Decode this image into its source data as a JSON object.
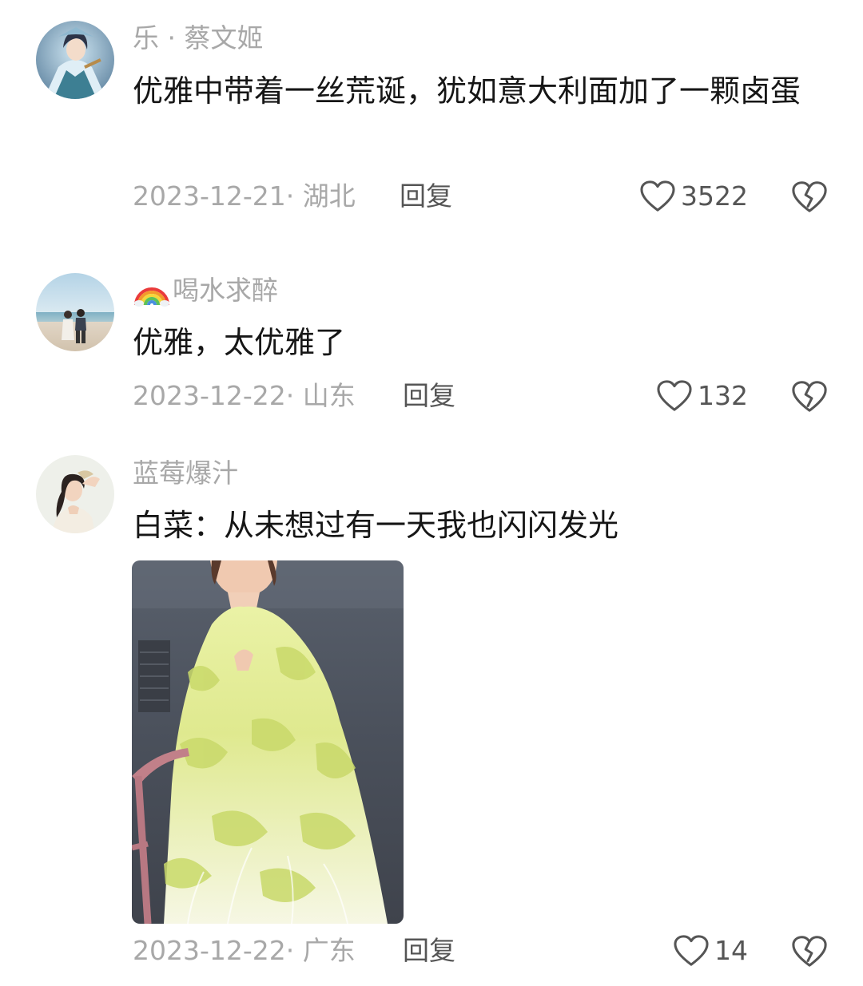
{
  "comments": [
    {
      "username": "乐 · 蔡文姬",
      "content": "优雅中带着一丝荒诞，犹如意大利面加了一颗卤蛋",
      "date_location": "2023-12-21· 湖北",
      "reply_label": "回复",
      "like_count": "3522"
    },
    {
      "username_emoji": "rainbow-icon",
      "username": "喝水求醉",
      "content": "优雅，太优雅了",
      "date_location": "2023-12-22· 山东",
      "reply_label": "回复",
      "like_count": "132"
    },
    {
      "username": "蓝莓爆汁",
      "content": "白菜：从未想过有一天我也闪闪发光",
      "date_location": "2023-12-22· 广东",
      "reply_label": "回复",
      "like_count": "14"
    }
  ],
  "icons": {
    "like": "heart-outline-icon",
    "dislike": "broken-heart-icon"
  },
  "colors": {
    "text_primary": "#161616",
    "text_secondary": "#a8a8a8",
    "text_action": "#555555"
  }
}
